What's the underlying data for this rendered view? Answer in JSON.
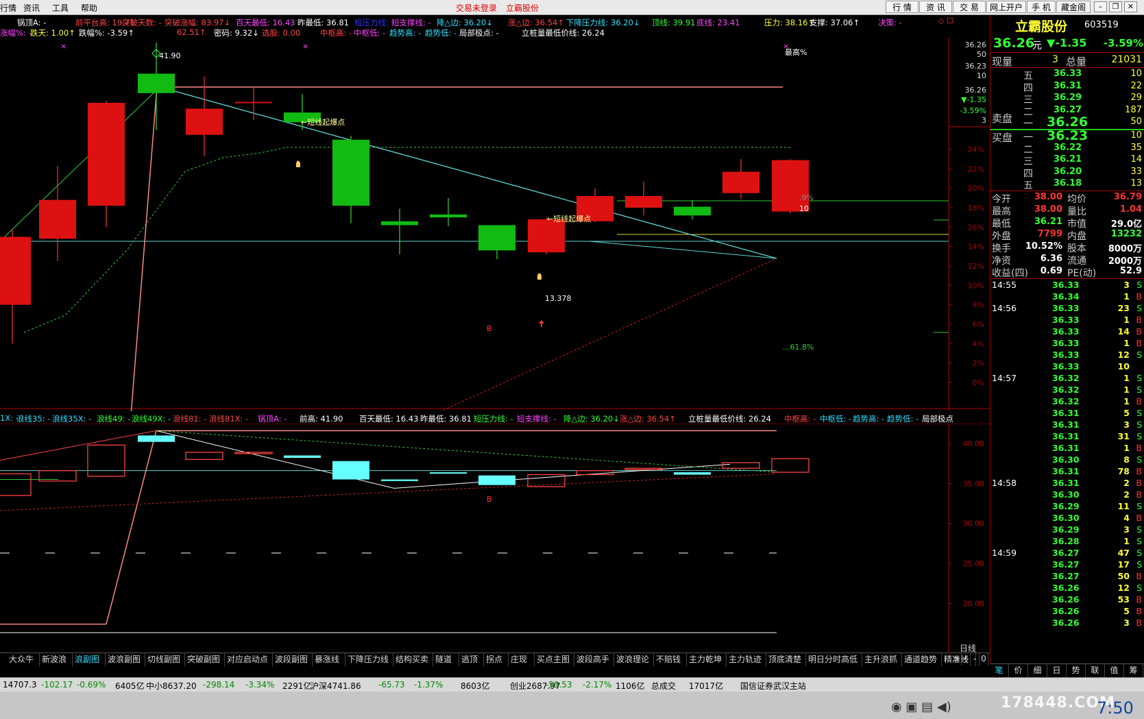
{
  "menubar": {
    "items": [
      "行情",
      "资讯",
      "工具",
      "帮助"
    ],
    "center": [
      "交易未登录",
      "立霸股份"
    ],
    "right_buttons": [
      "行 情",
      "资 讯",
      "交 易",
      "网上开户",
      "手 机",
      "藏金阁"
    ]
  },
  "header1": [
    {
      "t": "锅顶A: -",
      "c": "#ffffff"
    },
    {
      "t": "前平台高: 19.71",
      "c": "#ff4444"
    },
    {
      "t": "突破天数: -",
      "c": "#ff4444"
    },
    {
      "t": "突破涨幅: 83.97↓",
      "c": "#ff4444"
    },
    {
      "t": "百天最低: 16.43",
      "c": "#ff44ff"
    },
    {
      "t": "昨最低: 36.81",
      "c": "#ffffff"
    },
    {
      "t": "短压力线: -",
      "c": "#3333ff"
    },
    {
      "t": "短支撑线: -",
      "c": "#ff44ff"
    },
    {
      "t": "降△边: 36.20↓",
      "c": "#33ddff"
    },
    {
      "t": "涨△边: 36.54↑",
      "c": "#ff4444"
    },
    {
      "t": "下降压力线: 36.20↓",
      "c": "#33ddff"
    },
    {
      "t": "顶线: 39.91",
      "c": "#33ff33"
    },
    {
      "t": "底线: 23.41",
      "c": "#ff44ff"
    },
    {
      "t": "压力: 38.16↑",
      "c": "#ffff33"
    },
    {
      "t": "支撑: 37.06↑",
      "c": "#ffffff"
    },
    {
      "t": "决策: -",
      "c": "#ff44ff"
    }
  ],
  "header2": [
    {
      "t": "涨幅%: -",
      "c": "#ff44ff"
    },
    {
      "t": "跌天: 1.00↑",
      "c": "#ffff33"
    },
    {
      "t": "跌幅%: -3.59↑",
      "c": "#ffffff"
    },
    {
      "t": "62.51↑",
      "c": "#ff4444"
    },
    {
      "t": "密码: 9.32↓",
      "c": "#ffffff"
    },
    {
      "t": "选股: 0.00",
      "c": "#ff4444"
    },
    {
      "t": "中枢高: -",
      "c": "#ff4444"
    },
    {
      "t": "中枢低: -",
      "c": "#ff44ff"
    },
    {
      "t": "趋势高: -",
      "c": "#33ddff"
    },
    {
      "t": "趋势低: -",
      "c": "#33ddff"
    },
    {
      "t": "局部极点: -",
      "c": "#ffffff"
    },
    {
      "t": "立桩量最低价线: 26.24",
      "c": "#ffffff"
    }
  ],
  "header3": [
    {
      "t": "1X: -",
      "c": "#33ddff"
    },
    {
      "t": "浪线35: -",
      "c": "#33ddff"
    },
    {
      "t": "浪线35X: -",
      "c": "#33ddff"
    },
    {
      "t": "浪线49: -",
      "c": "#33ff33"
    },
    {
      "t": "浪线49X: -",
      "c": "#33ff33"
    },
    {
      "t": "浪线81: -",
      "c": "#ff4444"
    },
    {
      "t": "浪线81X: -",
      "c": "#ff4444"
    },
    {
      "t": "锅顶A: -",
      "c": "#ff44ff"
    },
    {
      "t": "前高: 41.90",
      "c": "#ffffff"
    },
    {
      "t": "百天最低: 16.43",
      "c": "#ffffff"
    },
    {
      "t": "昨最低: 36.81",
      "c": "#ffffff"
    },
    {
      "t": "短压力线: -",
      "c": "#33ff33"
    },
    {
      "t": "短支撑线: -",
      "c": "#ff44ff"
    },
    {
      "t": "降△边: 36.20↓",
      "c": "#33ff33"
    },
    {
      "t": "涨△边: 36.54↑",
      "c": "#ff4444"
    },
    {
      "t": "立桩量最低价线: 26.24",
      "c": "#ffffff"
    },
    {
      "t": "中枢高: -",
      "c": "#ff4444"
    },
    {
      "t": "中枢低: -",
      "c": "#33ddff"
    },
    {
      "t": "趋势高: -",
      "c": "#33ddff"
    },
    {
      "t": "趋势低: -",
      "c": "#33ddff"
    },
    {
      "t": "局部极点",
      "c": "#ffffff"
    }
  ],
  "chart_data": [
    {
      "type": "candlestick",
      "title": "",
      "ylim": [
        -0.6,
        26
      ],
      "axis_percent_ticks": [
        "24%",
        "22%",
        "20%",
        "18%",
        "16%",
        "14%",
        "12%",
        "10%",
        "8%",
        "6%",
        "4%",
        "2%",
        "0%"
      ],
      "axis_top_labels": [
        "36.26",
        "50",
        "36.23",
        "10",
        "36.26",
        "▼-1.35",
        "-3.59%",
        "3"
      ],
      "candles": [
        {
          "o": 8.0,
          "c": 15.0,
          "h": 15.8,
          "l": 4.0
        },
        {
          "o": 14.8,
          "c": 18.8,
          "h": 22.3,
          "l": 12.5
        },
        {
          "o": 18.2,
          "c": 28.8,
          "h": 29.0,
          "l": 16.0
        },
        {
          "o": 31.8,
          "c": 29.8,
          "h": 35.0,
          "l": 26.0
        },
        {
          "o": 25.5,
          "c": 28.2,
          "h": 31.5,
          "l": 23.3
        },
        {
          "o": 28.8,
          "c": 28.9,
          "h": 30.3,
          "l": 27.0
        },
        {
          "o": 27.8,
          "c": 26.8,
          "h": 29.7,
          "l": 26.0
        },
        {
          "o": 25.0,
          "c": 18.2,
          "h": 25.4,
          "l": 16.4
        },
        {
          "o": 16.6,
          "c": 16.2,
          "h": 17.9,
          "l": 13.2
        },
        {
          "o": 17.3,
          "c": 17.0,
          "h": 19.0,
          "l": 16.1
        },
        {
          "o": 16.2,
          "c": 13.6,
          "h": 16.2,
          "l": 12.7
        },
        {
          "o": 13.4,
          "c": 16.8,
          "h": 17.0,
          "l": 13.2
        },
        {
          "o": 16.6,
          "c": 19.2,
          "h": 20.0,
          "l": 16.5
        },
        {
          "o": 18.0,
          "c": 19.2,
          "h": 20.7,
          "l": 17.2
        },
        {
          "o": 18.1,
          "c": 17.2,
          "h": 18.8,
          "l": 16.8
        },
        {
          "o": 19.5,
          "c": 21.7,
          "h": 23.0,
          "l": 18.9
        },
        {
          "o": 17.6,
          "c": 22.9,
          "h": 23.0,
          "l": 17.4
        }
      ],
      "annotations": [
        "41.90",
        "←短线起爆点",
        "←短线起爆点",
        "13.378",
        "B",
        "最高%",
        "...61.8%",
        ".9%",
        "10"
      ]
    },
    {
      "type": "candlestick",
      "title": "",
      "ylim": [
        15,
        45
      ],
      "y_ticks": [
        "40.00",
        "35.00",
        "30.00",
        "25.00",
        "20.00"
      ],
      "candles": [
        {
          "o": 33.5,
          "c": 36.2
        },
        {
          "o": 35.3,
          "c": 36.6
        },
        {
          "o": 35.9,
          "c": 39.8
        },
        {
          "o": 41.0,
          "c": 40.2
        },
        {
          "o": 38.0,
          "c": 38.9
        },
        {
          "o": 38.8,
          "c": 38.9
        },
        {
          "o": 38.5,
          "c": 38.2
        },
        {
          "o": 37.8,
          "c": 35.5
        },
        {
          "o": 35.5,
          "c": 35.3
        },
        {
          "o": 36.4,
          "c": 36.3
        },
        {
          "o": 36.0,
          "c": 34.8
        },
        {
          "o": 34.6,
          "c": 36.1
        },
        {
          "o": 36.1,
          "c": 36.6
        },
        {
          "o": 36.8,
          "c": 36.9
        },
        {
          "o": 36.4,
          "c": 36.1
        },
        {
          "o": 36.9,
          "c": 37.6
        },
        {
          "o": 36.4,
          "c": 38.1
        }
      ],
      "annotations": [
        "B"
      ]
    }
  ],
  "panel": {
    "name": "立霸股份",
    "code": "603519",
    "price": "36.26",
    "price_unit": "元",
    "change": "▼-1.35",
    "change_pct": "-3.59%",
    "now_vol_label": "现量",
    "now_vol": "3",
    "total_vol_label": "总量",
    "total_vol": "21031",
    "sell_label": "卖盘",
    "buy_label": "买盘",
    "asks": [
      {
        "lvl": "五",
        "p": "36.33",
        "v": "10"
      },
      {
        "lvl": "四",
        "p": "36.31",
        "v": "22"
      },
      {
        "lvl": "三",
        "p": "36.29",
        "v": "29"
      },
      {
        "lvl": "二",
        "p": "36.27",
        "v": "187"
      },
      {
        "lvl": "一",
        "p": "36.26",
        "v": "50"
      }
    ],
    "bids": [
      {
        "lvl": "一",
        "p": "36.23",
        "v": "10"
      },
      {
        "lvl": "二",
        "p": "36.22",
        "v": "35"
      },
      {
        "lvl": "三",
        "p": "36.21",
        "v": "14"
      },
      {
        "lvl": "四",
        "p": "36.20",
        "v": "33"
      },
      {
        "lvl": "五",
        "p": "36.18",
        "v": "13"
      }
    ],
    "stats": [
      {
        "l1": "今开",
        "v1": "38.00",
        "c1": "red",
        "l2": "均价",
        "v2": "36.79",
        "c2": "red"
      },
      {
        "l1": "最高",
        "v1": "38.00",
        "c1": "red",
        "l2": "量比",
        "v2": "1.04",
        "c2": "red"
      },
      {
        "l1": "最低",
        "v1": "36.21",
        "c1": "grn",
        "l2": "市值",
        "v2": "29.0亿",
        "c2": "wht"
      },
      {
        "l1": "外盘",
        "v1": "7799",
        "c1": "red",
        "l2": "内盘",
        "v2": "13232",
        "c2": "grn"
      },
      {
        "l1": "换手",
        "v1": "10.52%",
        "c1": "wht",
        "l2": "股本",
        "v2": "8000万",
        "c2": "wht"
      },
      {
        "l1": "净资",
        "v1": "6.36",
        "c1": "wht",
        "l2": "流通",
        "v2": "2000万",
        "c2": "wht"
      },
      {
        "l1": "收益(四)",
        "v1": "0.69",
        "c1": "wht",
        "l2": "PE(动)",
        "v2": "52.9",
        "c2": "wht"
      }
    ],
    "ticks": [
      {
        "t": "14:55",
        "p": "36.33",
        "v": "3",
        "s": "S"
      },
      {
        "t": "",
        "p": "36.34",
        "v": "1",
        "s": "B"
      },
      {
        "t": "14:56",
        "p": "36.33",
        "v": "23",
        "s": "S"
      },
      {
        "t": "",
        "p": "36.33",
        "v": "1",
        "s": "B"
      },
      {
        "t": "",
        "p": "36.33",
        "v": "14",
        "s": "B"
      },
      {
        "t": "",
        "p": "36.33",
        "v": "1",
        "s": "B"
      },
      {
        "t": "",
        "p": "36.33",
        "v": "12",
        "s": "S"
      },
      {
        "t": "",
        "p": "36.33",
        "v": "10",
        "s": ""
      },
      {
        "t": "14:57",
        "p": "36.32",
        "v": "1",
        "s": "S"
      },
      {
        "t": "",
        "p": "36.32",
        "v": "1",
        "s": "S"
      },
      {
        "t": "",
        "p": "36.32",
        "v": "1",
        "s": "B"
      },
      {
        "t": "",
        "p": "36.31",
        "v": "5",
        "s": "S"
      },
      {
        "t": "",
        "p": "36.31",
        "v": "3",
        "s": "S"
      },
      {
        "t": "",
        "p": "36.31",
        "v": "31",
        "s": "S"
      },
      {
        "t": "",
        "p": "36.31",
        "v": "1",
        "s": "B"
      },
      {
        "t": "",
        "p": "36.30",
        "v": "8",
        "s": "S"
      },
      {
        "t": "",
        "p": "36.31",
        "v": "78",
        "s": "B"
      },
      {
        "t": "14:58",
        "p": "36.31",
        "v": "2",
        "s": "B"
      },
      {
        "t": "",
        "p": "36.30",
        "v": "2",
        "s": "B"
      },
      {
        "t": "",
        "p": "36.29",
        "v": "11",
        "s": "S"
      },
      {
        "t": "",
        "p": "36.30",
        "v": "4",
        "s": "B"
      },
      {
        "t": "",
        "p": "36.29",
        "v": "3",
        "s": "S"
      },
      {
        "t": "",
        "p": "36.28",
        "v": "1",
        "s": "S"
      },
      {
        "t": "14:59",
        "p": "36.27",
        "v": "47",
        "s": "S"
      },
      {
        "t": "",
        "p": "36.27",
        "v": "17",
        "s": "S"
      },
      {
        "t": "",
        "p": "36.27",
        "v": "50",
        "s": "B"
      },
      {
        "t": "",
        "p": "36.26",
        "v": "12",
        "s": "S"
      },
      {
        "t": "",
        "p": "36.26",
        "v": "53",
        "s": "B"
      },
      {
        "t": "",
        "p": "36.26",
        "v": "5",
        "s": "B"
      },
      {
        "t": "",
        "p": "36.26",
        "v": "3",
        "s": "B"
      }
    ]
  },
  "tabs": [
    "大众牛",
    "新波浪",
    "浪副图",
    "波浪副图",
    "切线副图",
    "突破副图",
    "对应启动点",
    "波段副图",
    "暴涨线",
    "下降压力线",
    "结构买卖",
    "隧道",
    "逃顶",
    "拐点",
    "庄现",
    "买点主图",
    "波段高手",
    "波浪理论",
    "不赔钱",
    "主力乾坤",
    "主力轨迹",
    "顶底清楚",
    "明日分时高低",
    "主升浪抓",
    "通道趋势",
    "精准线"
  ],
  "active_tab": "浪副图",
  "tab_nav": [
    "日线",
    ">",
    "+",
    "-",
    "0"
  ],
  "right_tabs": [
    "笔",
    "价",
    "细",
    "日",
    "势",
    "联",
    "值",
    "筹"
  ],
  "status": [
    {
      "t": "14707.3",
      "c": "#000"
    },
    {
      "t": "-102.17",
      "c": "#008800"
    },
    {
      "t": "-0.69%",
      "c": "#008800"
    },
    {
      "t": "6405亿",
      "c": "#000"
    },
    {
      "t": "中小8637.20",
      "c": "#000"
    },
    {
      "t": "-298.14",
      "c": "#008800"
    },
    {
      "t": "-3.34%",
      "c": "#008800"
    },
    {
      "t": "2291亿",
      "c": "#000"
    },
    {
      "t": "沪深4741.86",
      "c": "#000"
    },
    {
      "t": "-65.73",
      "c": "#008800"
    },
    {
      "t": "-1.37%",
      "c": "#008800"
    },
    {
      "t": "8603亿",
      "c": "#000"
    },
    {
      "t": "创业2687.97",
      "c": "#000"
    },
    {
      "t": "-59.53",
      "c": "#008800"
    },
    {
      "t": "-2.17%",
      "c": "#008800"
    },
    {
      "t": "1106亿",
      "c": "#000"
    },
    {
      "t": "总成交",
      "c": "#000"
    },
    {
      "t": "17017亿",
      "c": "#000"
    },
    {
      "t": "国信证券武汉主站",
      "c": "#000"
    }
  ],
  "watermark": "178448.COM",
  "clock": "7:50"
}
